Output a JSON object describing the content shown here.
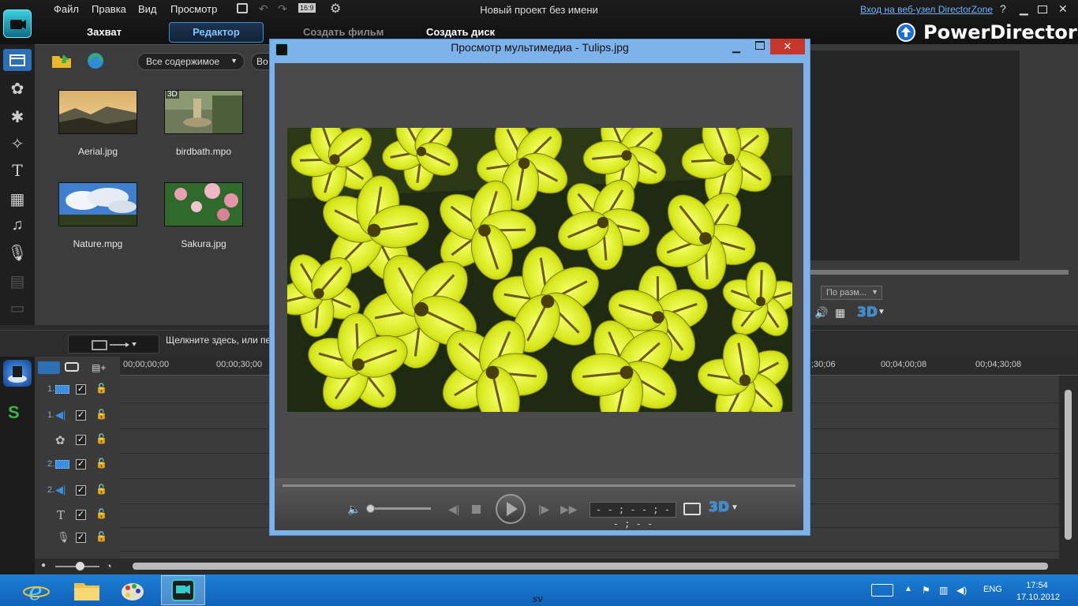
{
  "app": {
    "menus": [
      "Файл",
      "Правка",
      "Вид",
      "Просмотр"
    ],
    "aspect": "16:9",
    "window_title": "Новый проект без имени",
    "directorzone_link": "Вход на веб-узел DirectorZone",
    "help": "?",
    "brand": "PowerDirector"
  },
  "modes": {
    "capture": "Захват",
    "editor": "Редактор",
    "create_movie": "Создать фильм",
    "create_disc": "Создать диск"
  },
  "library": {
    "filter_label": "Все содержимое",
    "filter2_label": "Во",
    "items": [
      {
        "label": "Aerial.jpg",
        "badge": ""
      },
      {
        "label": "birdbath.mpo",
        "badge": "3D"
      },
      {
        "label": "Nature.mpg",
        "badge": ""
      },
      {
        "label": "Sakura.jpg",
        "badge": ""
      }
    ]
  },
  "preview": {
    "fit_label": "По разм...",
    "badge_3d": "3D"
  },
  "timeline": {
    "hint": "Щелкните здесь, или пе",
    "ticks": [
      "00;00;00;00",
      "00;00;30;00",
      ";30;06",
      "00;04;00;08",
      "00;04;30;08"
    ],
    "tracks": [
      {
        "num": "1.",
        "kind": "video"
      },
      {
        "num": "1.",
        "kind": "audio"
      },
      {
        "num": "",
        "kind": "fx"
      },
      {
        "num": "2.",
        "kind": "video"
      },
      {
        "num": "2.",
        "kind": "audio"
      },
      {
        "num": "",
        "kind": "title"
      },
      {
        "num": "",
        "kind": "voice"
      },
      {
        "num": "",
        "kind": "music"
      }
    ]
  },
  "media_viewer": {
    "title": "Просмотр мультимедиа - Tulips.jpg",
    "timecode": "- - ; - - ; - - ; - -",
    "badge_3d": "3D"
  },
  "taskbar": {
    "lang": "ENG",
    "time": "17:54",
    "date": "17.10.2012",
    "watermark": "sv"
  },
  "colors": {
    "accent": "#3f8fd0",
    "taskbar": "#1d7fd6",
    "modal_border": "#7db3ea",
    "close_red": "#c7362a"
  }
}
